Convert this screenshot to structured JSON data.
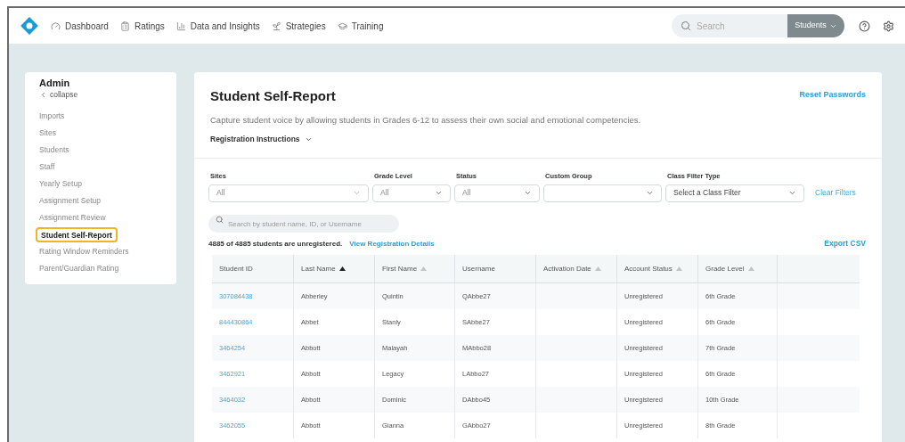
{
  "nav": {
    "items": [
      {
        "label": "Dashboard"
      },
      {
        "label": "Ratings"
      },
      {
        "label": "Data and Insights"
      },
      {
        "label": "Strategies"
      },
      {
        "label": "Training"
      }
    ],
    "search": {
      "placeholder": "Search"
    },
    "scope": {
      "label": "Students"
    }
  },
  "sidebar": {
    "title": "Admin",
    "collapse": "collapse",
    "items": [
      {
        "label": "Imports",
        "selected": false
      },
      {
        "label": "Sites",
        "selected": false
      },
      {
        "label": "Students",
        "selected": false
      },
      {
        "label": "Staff",
        "selected": false
      },
      {
        "label": "Yearly Setup",
        "selected": false
      },
      {
        "label": "Assignment Setup",
        "selected": false
      },
      {
        "label": "Assignment Review",
        "selected": false
      },
      {
        "label": "Student Self-Report",
        "selected": true
      },
      {
        "label": "Rating Window Reminders",
        "selected": false
      },
      {
        "label": "Parent/Guardian Rating",
        "selected": false
      }
    ]
  },
  "page": {
    "title": "Student Self-Report",
    "reset": "Reset Passwords",
    "description": "Capture student voice by allowing students in Grades 6-12 to assess their own social and emotional competencies.",
    "instructions": "Registration Instructions",
    "filters": [
      {
        "label": "Sites",
        "value": "All",
        "kind": "value"
      },
      {
        "label": "Grade Level",
        "value": "All",
        "kind": "value"
      },
      {
        "label": "Status",
        "value": "All",
        "kind": "value"
      },
      {
        "label": "Custom Group",
        "kind": "empty"
      },
      {
        "label": "Class Filter Type",
        "value": "Select a Class Filter",
        "kind": "prompt"
      }
    ],
    "clear": "Clear Filters",
    "search": {
      "placeholder": "Search by student name, ID, or Username"
    },
    "summary": "4885 of 4885 students are unregistered.",
    "details": "View Registration Details",
    "export": "Export CSV"
  },
  "table": {
    "columns": [
      {
        "label": "Student ID",
        "sortable": false
      },
      {
        "label": "Last Name",
        "sortable": true,
        "sorted": true
      },
      {
        "label": "First Name",
        "sortable": true,
        "sorted": false
      },
      {
        "label": "Username",
        "sortable": false
      },
      {
        "label": "Activation Date",
        "sortable": true,
        "sorted": false
      },
      {
        "label": "Account Status",
        "sortable": true,
        "sorted": false
      },
      {
        "label": "Grade Level",
        "sortable": true,
        "sorted": false
      }
    ],
    "rows": [
      [
        "307084438",
        "Abberley",
        "Quintin",
        "QAbbe27",
        "",
        "Unregistered",
        "6th Grade"
      ],
      [
        "844430864",
        "Abbet",
        "Stanly",
        "SAbbe27",
        "",
        "Unregistered",
        "6th Grade"
      ],
      [
        "3464254",
        "Abbott",
        "Malayah",
        "MAbbo28",
        "",
        "Unregistered",
        "7th Grade"
      ],
      [
        "3462921",
        "Abbott",
        "Legacy",
        "LAbbo27",
        "",
        "Unregistered",
        "6th Grade"
      ],
      [
        "3464032",
        "Abbott",
        "Dominic",
        "DAbbo45",
        "",
        "Unregistered",
        "10th Grade"
      ],
      [
        "3462055",
        "Abbott",
        "Gianna",
        "GAbbo27",
        "",
        "Unregistered",
        "8th Grade"
      ]
    ]
  }
}
